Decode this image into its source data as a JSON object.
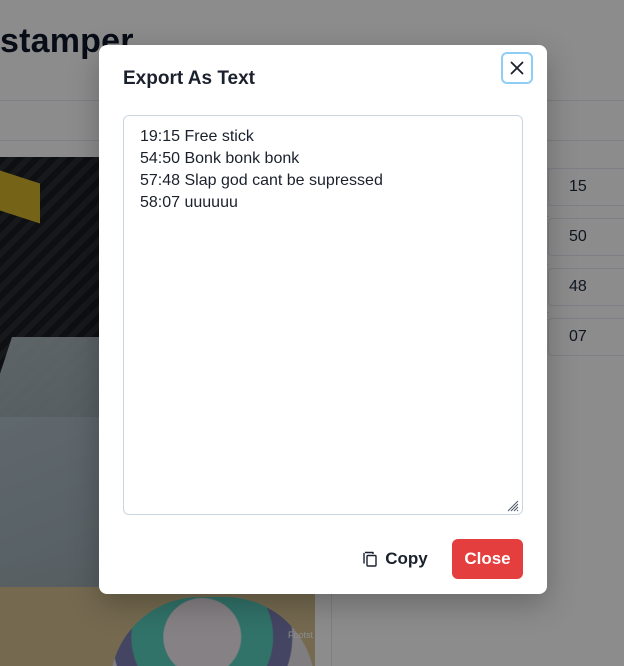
{
  "background": {
    "page_title": "stamper",
    "table_values": [
      "15",
      "50",
      "48",
      "07"
    ],
    "video_overlay_text": "Footst"
  },
  "modal": {
    "title": "Export As Text",
    "textarea_value": "19:15 Free stick\n54:50 Bonk bonk bonk\n57:48 Slap god cant be supressed\n58:07 uuuuuu",
    "copy_label": "Copy",
    "close_label": "Close",
    "icons": {
      "close": "close-icon",
      "copy": "copy-icon",
      "resize": "resize-grip-icon"
    }
  },
  "colors": {
    "overlay": "rgba(0,0,0,0.45)",
    "close_button_bg": "#e53e3e",
    "focus_ring": "#90cdf4",
    "text": "#1a202c"
  }
}
